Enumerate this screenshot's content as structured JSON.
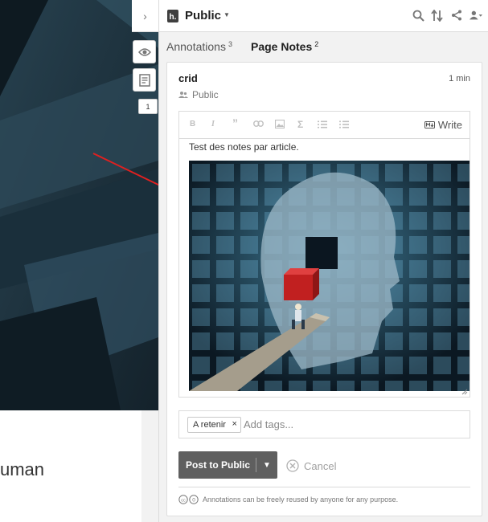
{
  "host": {
    "partial_text": "uman"
  },
  "toolbar": {
    "annotation_count": "1"
  },
  "topbar": {
    "group_name": "Public"
  },
  "tabs": [
    {
      "label": "Annotations",
      "count": "3"
    },
    {
      "label": "Page Notes",
      "count": "2"
    }
  ],
  "card": {
    "user": "crid",
    "time": "1 min",
    "privacy": "Public",
    "editor": {
      "toolbar_buttons": [
        "B",
        "I",
        "”",
        "link",
        "image",
        "Σ",
        "ol",
        "ul"
      ],
      "write_label": "Write",
      "note_text": "Test des notes par article."
    },
    "tags": {
      "items": [
        "A retenir"
      ],
      "placeholder": "Add tags..."
    },
    "post_label": "Post to Public",
    "cancel_label": "Cancel",
    "license_text": "Annotations can be freely reused by anyone for any purpose."
  },
  "colors": {
    "accent_arrow": "#e02020",
    "post_button": "#5f5f5f",
    "sidebar_bg": "#f2f2f2"
  }
}
